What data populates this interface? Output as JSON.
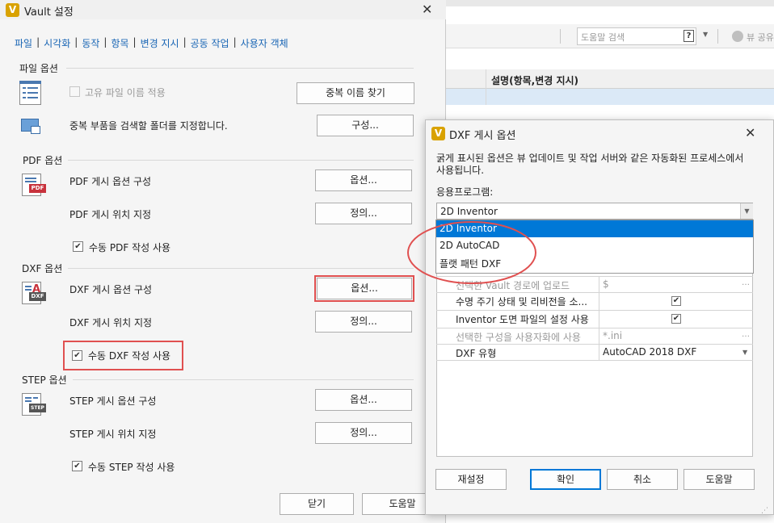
{
  "vault_dialog": {
    "title": "Vault 설정",
    "tabs": [
      {
        "label": "파일"
      },
      {
        "label": "시각화"
      },
      {
        "label": "동작"
      },
      {
        "label": "항목"
      },
      {
        "label": "변경 지시"
      },
      {
        "label": "공동 작업"
      },
      {
        "label": "사용자 객체"
      }
    ],
    "tab_separator": "|",
    "file_options": {
      "label": "파일 옵션",
      "unique_name_checkbox": "고유 파일 이름 적용",
      "find_duplicates_button": "중복 이름 찾기",
      "duplicate_search_text": "중복 부품을 검색할 폴더를 지정합니다.",
      "configure_button": "구성..."
    },
    "pdf_options": {
      "label": "PDF 옵션",
      "publish_options_text": "PDF 게시 옵션 구성",
      "options_button": "옵션...",
      "publish_location_text": "PDF 게시 위치 지정",
      "define_button": "정의...",
      "manual_checkbox": "수동 PDF 작성 사용"
    },
    "dxf_options": {
      "label": "DXF 옵션",
      "publish_options_text": "DXF 게시 옵션 구성",
      "options_button": "옵션...",
      "publish_location_text": "DXF 게시 위치 지정",
      "define_button": "정의...",
      "manual_checkbox": "수동 DXF 작성 사용"
    },
    "step_options": {
      "label": "STEP 옵션",
      "publish_options_text": "STEP 게시 옵션 구성",
      "options_button": "옵션...",
      "publish_location_text": "STEP 게시 위치 지정",
      "define_button": "정의...",
      "manual_checkbox": "수동 STEP 작성 사용"
    },
    "close_button": "닫기",
    "help_button": "도움말",
    "icons": {
      "pdf_badge": "PDF",
      "dxf_badge": "DXF",
      "step_badge": "STEP",
      "dxf_letter": "A"
    }
  },
  "background_app": {
    "search_placeholder": "도움말 검색",
    "help_glyph": "?",
    "view_label": "뷰 공유",
    "grid_column": "설명(항목,변경 지시)"
  },
  "dxf_dialog": {
    "title": "DXF 게시 옵션",
    "description": "굵게 표시된 옵션은 뷰 업데이트 및 작업 서버와 같은 자동화된 프로세스에서 사용됩니다.",
    "application_label": "응용프로그램:",
    "selected_application": "2D Inventor",
    "application_options": [
      "2D Inventor",
      "2D AutoCAD",
      "플랫 패턴 DXF"
    ],
    "grid_rows": [
      {
        "name": "선택한 Vault 경로에 업로드",
        "value": "$",
        "enabled": false,
        "checkbox": false
      },
      {
        "name": "수명 주기 상태 및 리비전을 소...",
        "value": "",
        "enabled": true,
        "checkbox": true
      },
      {
        "name": "Inventor 도면 파일의 설정 사용",
        "value": "",
        "enabled": true,
        "checkbox": true
      },
      {
        "name": "선택한 구성을 사용자화에 사용",
        "value": "*.ini",
        "enabled": false,
        "checkbox": false
      },
      {
        "name": "DXF 유형",
        "value": "AutoCAD 2018 DXF",
        "enabled": true,
        "checkbox": false
      }
    ],
    "reset_button": "재설정",
    "ok_button": "확인",
    "cancel_button": "취소",
    "help_button": "도움말"
  },
  "colors": {
    "accent": "#1a66b5",
    "highlight": "#0078d7",
    "annotation_red": "#e05050",
    "vault_icon": "#d9a200",
    "pdf_red": "#c8323c"
  }
}
